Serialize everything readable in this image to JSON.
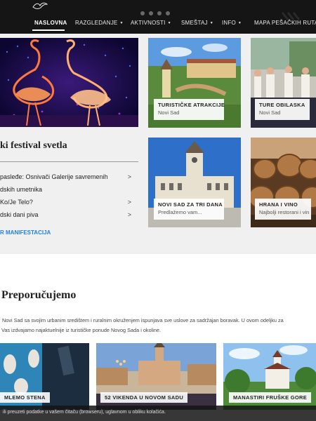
{
  "header": {
    "nav": [
      {
        "label": "NASLOVNA",
        "active": true,
        "caret": false
      },
      {
        "label": "RAZGLEDANJE",
        "active": false,
        "caret": true
      },
      {
        "label": "AKTIVNOSTI",
        "active": false,
        "caret": true
      },
      {
        "label": "SMEŠTAJ",
        "active": false,
        "caret": true
      },
      {
        "label": "INFO",
        "active": false,
        "caret": true
      },
      {
        "label": "MAPA PEŠAČKIH RUTA",
        "active": false,
        "caret": false
      }
    ],
    "caret_icon": "chevron-down-icon",
    "logo_icon": "bird-logo-icon"
  },
  "festival": {
    "title": "ki festival svetla",
    "events": [
      {
        "label": "pasleđe: Osnivači Galerije savremenih",
        "chevron": true
      },
      {
        "label": "dskih umetnika",
        "chevron": false
      },
      {
        "label": "Ko/Je Telo?",
        "chevron": true
      },
      {
        "label": "dski dani piva",
        "chevron": true
      }
    ],
    "more_link": "R MANIFESTACIJA"
  },
  "tiles": {
    "t1": {
      "title": "TURISTIČKE ATRAKCIJE",
      "subtitle": "Novi Sad"
    },
    "t2": {
      "title": "TURE OBILASKA",
      "subtitle": "Novi Sad"
    },
    "t3": {
      "title": "NOVI SAD ZA TRI DANA",
      "subtitle": "Predlažemo vam..."
    },
    "t4": {
      "title": "HRANA I VINO",
      "subtitle": "Najbolji restorani i vin"
    }
  },
  "recommended": {
    "title": "Preporučujemo",
    "line1": "Novi Sad sa svojim urbanim središtem i ruralnim okruženjem ispunjava sve uslove za sadržajan boravak. U ovom odeljku za",
    "line2": "Vas izdvajamo najaktuelnije iz turističke ponude Novog Sada i okoline.",
    "cards": [
      {
        "title": "MLEMO STENA"
      },
      {
        "title": "52 VIKENDA U NOVOM SADU"
      },
      {
        "title": "MANASTIRI FRUŠKE GORE"
      }
    ]
  },
  "cookie": {
    "text": "ili preuzeti podatke u vašem čitaču (browseru), uglavnom u obliku kolačića."
  },
  "colors": {
    "header_bg": "#151515",
    "link_blue": "#2a7fd1",
    "band_bg": "#f0f0f0"
  }
}
